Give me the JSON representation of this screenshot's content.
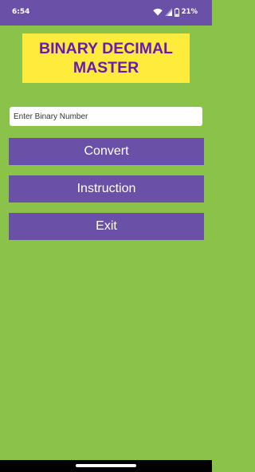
{
  "status_bar": {
    "time": "6:54",
    "battery": "21%",
    "icons": [
      "wifi-icon",
      "signal-icon",
      "battery-icon"
    ]
  },
  "app": {
    "title": "BINARY DECIMAL MASTER"
  },
  "input": {
    "value": "",
    "placeholder": "Enter Binary Number"
  },
  "buttons": {
    "convert": "Convert",
    "instruction": "Instruction",
    "exit": "Exit"
  },
  "colors": {
    "background": "#8bc34a",
    "primary": "#6a50a7",
    "title_bg": "#ffeb3b",
    "title_text": "#6a1ab0"
  }
}
